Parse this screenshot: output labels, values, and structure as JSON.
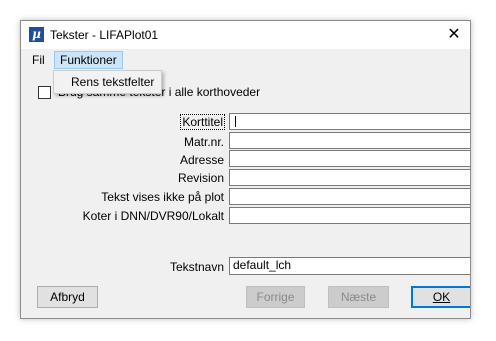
{
  "window": {
    "title": "Tekster - LIFAPlot01",
    "app_icon": "µ",
    "close_glyph": "✕"
  },
  "menu": {
    "items": [
      "Fil",
      "Funktioner"
    ],
    "dropdown_items": [
      "Rens tekstfelter"
    ]
  },
  "checkbox": {
    "label": "Brug samme tekster i alle korthoveder",
    "checked": false
  },
  "fields": [
    {
      "label": "Korttitel",
      "value": ""
    },
    {
      "label": "Matr.nr.",
      "value": ""
    },
    {
      "label": "Adresse",
      "value": ""
    },
    {
      "label": "Revision",
      "value": ""
    },
    {
      "label": "Tekst vises ikke på plot",
      "value": ""
    },
    {
      "label": "Koter i DNN/DVR90/Lokalt",
      "value": ""
    }
  ],
  "tekstnavn": {
    "label": "Tekstnavn",
    "value": "default_lch"
  },
  "buttons": {
    "cancel": "Afbryd",
    "prev": "Forrige",
    "next": "Næste",
    "ok": "OK"
  }
}
